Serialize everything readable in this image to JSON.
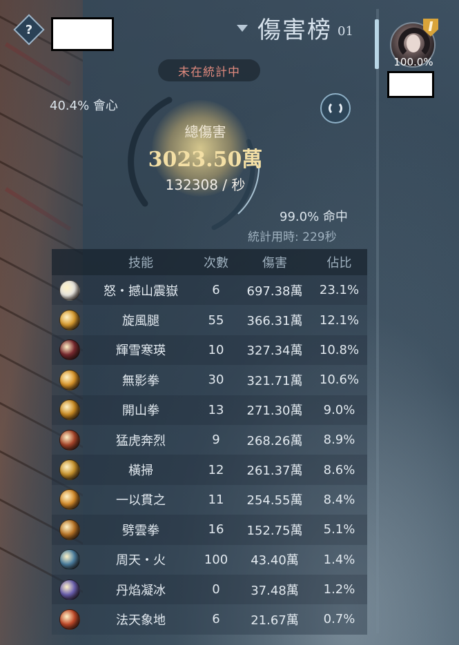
{
  "header": {
    "title": "傷害榜",
    "page_num": "01"
  },
  "help": {
    "icon_glyph": "?"
  },
  "player": {
    "share": "100.0%"
  },
  "status": {
    "not_counting": "未在統計中"
  },
  "summary": {
    "crit": "40.4% 會心",
    "total_label": "總傷害",
    "total_value": "3023.50萬",
    "dps": "132308 / 秒",
    "hit": "99.0% 命中",
    "time": "統計用時: 229秒"
  },
  "table": {
    "headers": [
      "技能",
      "次數",
      "傷害",
      "佔比"
    ],
    "rows": [
      {
        "skill": "怒・撼山震嶽",
        "count": "6",
        "damage": "697.38萬",
        "pct": "23.1%",
        "icon_color": "#e9e6df",
        "icon": "roar-skill-icon"
      },
      {
        "skill": "旋風腿",
        "count": "55",
        "damage": "366.31萬",
        "pct": "12.1%",
        "icon_color": "#d79a2e",
        "icon": "whirlwind-kick-icon"
      },
      {
        "skill": "輝雪寒瑛",
        "count": "10",
        "damage": "327.34萬",
        "pct": "10.8%",
        "icon_color": "#7a2a30",
        "icon": "snow-frost-icon"
      },
      {
        "skill": "無影拳",
        "count": "30",
        "damage": "321.71萬",
        "pct": "10.6%",
        "icon_color": "#d9952a",
        "icon": "shadowless-fist-icon"
      },
      {
        "skill": "開山拳",
        "count": "13",
        "damage": "271.30萬",
        "pct": "9.0%",
        "icon_color": "#c98a22",
        "icon": "mountain-fist-icon"
      },
      {
        "skill": "猛虎奔烈",
        "count": "9",
        "damage": "268.26萬",
        "pct": "8.9%",
        "icon_color": "#a8452a",
        "icon": "tiger-rush-icon"
      },
      {
        "skill": "橫掃",
        "count": "12",
        "damage": "261.37萬",
        "pct": "8.6%",
        "icon_color": "#c7922c",
        "icon": "sweep-icon"
      },
      {
        "skill": "一以貫之",
        "count": "11",
        "damage": "254.55萬",
        "pct": "8.4%",
        "icon_color": "#d38a2a",
        "icon": "pierce-through-icon"
      },
      {
        "skill": "劈雲拳",
        "count": "16",
        "damage": "152.75萬",
        "pct": "5.1%",
        "icon_color": "#b87426",
        "icon": "cloud-split-fist-icon"
      },
      {
        "skill": "周天・火",
        "count": "100",
        "damage": "43.40萬",
        "pct": "1.4%",
        "icon_color": "#4a7ea0",
        "icon": "celestial-fire-icon"
      },
      {
        "skill": "丹焰凝冰",
        "count": "0",
        "damage": "37.48萬",
        "pct": "1.2%",
        "icon_color": "#6a5fb0",
        "icon": "flame-ice-icon"
      },
      {
        "skill": "法天象地",
        "count": "6",
        "damage": "21.67萬",
        "pct": "0.7%",
        "icon_color": "#c24a2a",
        "icon": "heaven-earth-icon"
      }
    ]
  }
}
